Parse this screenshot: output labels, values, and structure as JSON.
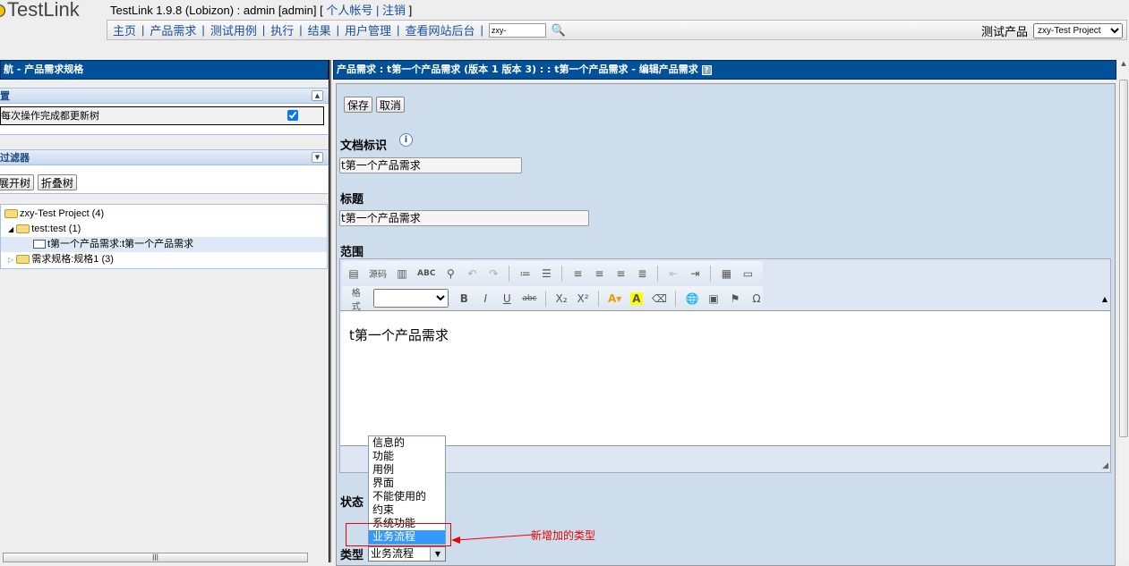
{
  "app": {
    "logo": "TestLink",
    "title": "TestLink 1.9.8 (Lobizon) : admin [admin] [",
    "title_end": "]",
    "account": "个人帐号",
    "logout": "注销"
  },
  "nav": {
    "items": [
      "主页",
      "产品需求",
      "测试用例",
      "执行",
      "结果",
      "用户管理",
      "查看网站后台"
    ],
    "search_value": "zxy-",
    "project_label": "测试产品",
    "project_value": "zxy-Test Project"
  },
  "left": {
    "header": "航 - 产品需求规格",
    "settings_title": "置",
    "settings_option": "每次操作完成都更新树",
    "settings_checked": true,
    "filter_title": "过滤器",
    "expand": "展开树",
    "collapse": "折叠树",
    "tree": [
      "zxy-Test Project (4)",
      "test:test (1)",
      "t第一个产品需求:t第一个产品需求",
      "需求规格:规格1 (3)"
    ]
  },
  "right": {
    "header": "产品需求 : t第一个产品需求 (版本 1 版本 3) : : t第一个产品需求 - 编辑产品需求",
    "save": "保存",
    "cancel": "取消",
    "docid_label": "文档标识",
    "docid_value": "t第一个产品需求",
    "title_label": "标题",
    "title_value": "t第一个产品需求",
    "scope_label": "范围",
    "toolbar_source": "源码",
    "toolbar_format": "格式",
    "editor_content": "t第一个产品需求",
    "status_label": "状态",
    "type_label": "类型",
    "type_value": "业务流程",
    "type_options": [
      "信息的",
      "功能",
      "用例",
      "界面",
      "不能使用的",
      "约束",
      "系统功能",
      "业务流程"
    ],
    "annotation": "新增加的类型",
    "annotation_color": "#ff0000"
  }
}
